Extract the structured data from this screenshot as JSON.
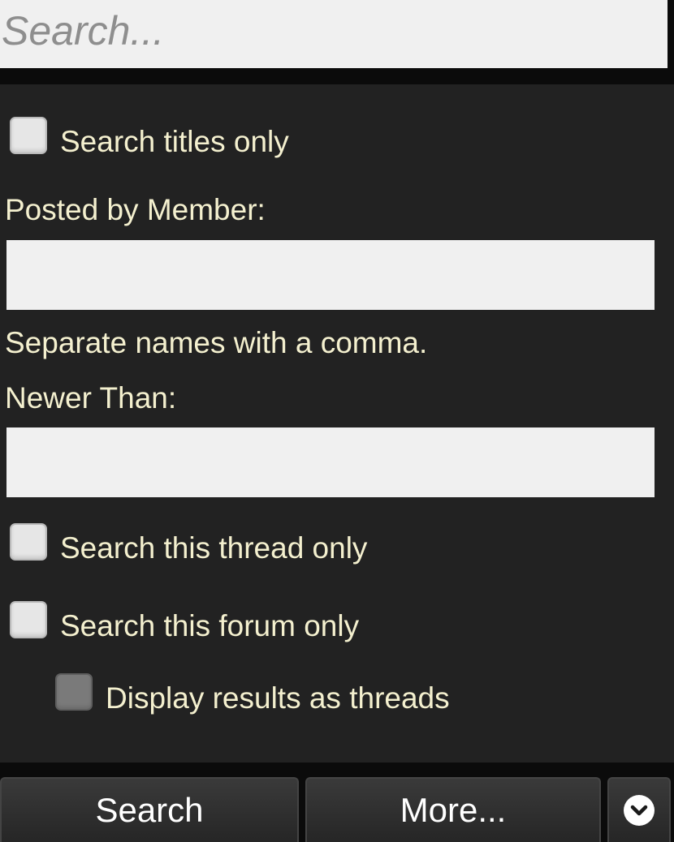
{
  "search": {
    "placeholder": "Search..."
  },
  "form": {
    "titles_only_label": "Search titles only",
    "posted_by_label": "Posted by Member:",
    "posted_by_value": "",
    "posted_by_hint": "Separate names with a comma.",
    "newer_than_label": "Newer Than:",
    "newer_than_value": "",
    "thread_only_label": "Search this thread only",
    "forum_only_label": "Search this forum only",
    "display_threads_label": "Display results as threads"
  },
  "buttons": {
    "search_label": "Search",
    "more_label": "More..."
  },
  "icons": {
    "toggle": "chevron-down-icon"
  },
  "colors": {
    "panel_background": "#222222",
    "label_text": "#f4f0cf",
    "field_background": "#f0f0f0"
  }
}
